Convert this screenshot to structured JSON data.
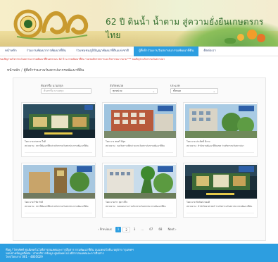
{
  "banner": {
    "title": "62 ปี ดินน้ำ น้ำตาม สู่ความยั่งยืนเกษตรกรไทย",
    "logo_text": "๖๒",
    "colors": {
      "title": "#2f6b2a",
      "accent": "#2d9ee0"
    }
  },
  "nav": {
    "items": [
      {
        "label": "หน้าหลัก",
        "active": false
      },
      {
        "label": "ร่วมงานพัฒนาการพัฒนาที่ดิน",
        "active": false
      },
      {
        "label": "ร่วมชมชมภูมิปัญญาพัฒนาที่ดินแห่งชาติ",
        "active": false
      },
      {
        "label": "ผู้ที่เข้าร่วมงานวันสถาปนากรมพัฒนาที่ดิน",
        "active": true
      },
      {
        "label": "ติดต่อเรา",
        "active": false
      }
    ]
  },
  "ticker": {
    "text": "ขอเชิญร่วมกิจกรรมวันสถาปนากรมพัฒนาที่ดินครบรอบ 62 ปี ณ กรมพัฒนาที่ดิน ร่วมชมนิทรรศการและกิจกรรมมากมาย *** ขอเชิญร่วมกิจกรรมวันสถาปนา"
  },
  "breadcrumb": {
    "home": "หน้าหลัก",
    "separator": "/",
    "current": "ผู้ที่เข้าร่วมงานวันสถาปนากรมพัฒนาที่ดิน"
  },
  "filters": {
    "name": {
      "label": "ค้นหาชื่อ นามสกุล",
      "placeholder": "ค้นหาชื่อ นามสกุล"
    },
    "unit": {
      "label": "สังกัดหน่วย",
      "value": "ทุกหน่วย"
    },
    "type": {
      "label": "ประเภท",
      "value": "ทั้งหมด"
    }
  },
  "cards": [
    {
      "meta": "โดย    นาย สมชาย ใจดี",
      "desc": "หน่วยงาน : สถานีพัฒนาที่ดินร่วมกิจกรรมวันสถาปนากรมพัฒนาที่ดิน"
    },
    {
      "meta": "โดย    นาง สมศรี มีสุข",
      "desc": "หน่วยงาน : กองวิเคราะห์ดินร่วมงานวันสถาปนากรมพัฒนาที่ดิน"
    },
    {
      "meta": "โดย    นาย ประสิทธิ์ ดีงาม",
      "desc": "หน่วยงาน : สำนักงานพัฒนาที่ดินเขต ร่วมกิจกรรมวันสถาปนา"
    },
    {
      "meta": "โดย    นาย วิชัย รักดี",
      "desc": "หน่วยงาน : สถานีพัฒนาที่ดินร่วมกิจกรรมวันสถาปนากรมพัฒนาที่ดิน"
    },
    {
      "meta": "โดย    นางสาว สุดา ดีใจ",
      "desc": "หน่วยงาน : กองแผนงาน ร่วมกิจกรรมวันสถาปนากรมพัฒนาที่ดิน"
    },
    {
      "meta": "โดย    นาย ชัยวัฒน์ ทองดี",
      "desc": "หน่วยงาน : สำนักวิทยาศาสตร์ ร่วมกิจกรรมวันสถาปนากรมพัฒนาที่ดิน"
    }
  ],
  "pagination": {
    "prev": "‹ Previous",
    "pages": [
      "1",
      "2",
      "3",
      "...",
      "67",
      "68"
    ],
    "active_page": "1",
    "next": "Next ›"
  },
  "footer": {
    "line1": "ที่อยู่ / โทรศัพท์ ศูนย์เทคโนโลยีสารสนเทศและการสื่อสาร กรมพัฒนาที่ดิน ถนนพหลโยธิน จตุจักร กรุงเทพฯ",
    "line2": "ขอบข่ายข้อมูลติดต่อ : ฝ่ายบริการข้อมูล ศูนย์เทคโนโลยีสารสนเทศและการสื่อสาร",
    "line3": "โทร/โทรสาร           061 - 4805029"
  }
}
